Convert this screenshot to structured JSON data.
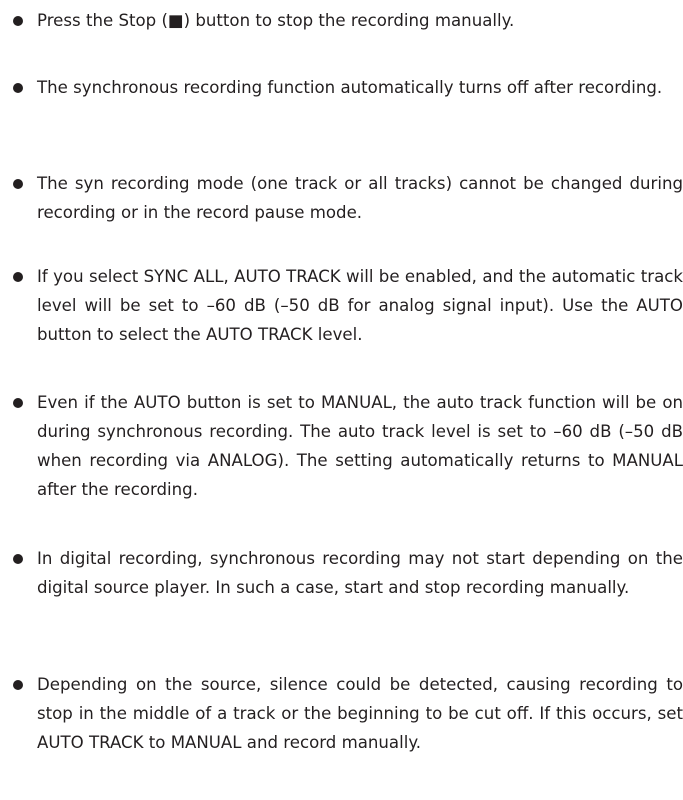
{
  "notes": [
    {
      "text": "Press the Stop (■) button to stop the recording manually."
    },
    {
      "text": "The synchronous recording function automatically turns off after recording."
    },
    {
      "text": "The syn recording mode (one track or all tracks) cannot be changed during recording or in the record pause mode."
    },
    {
      "text": "If you select SYNC ALL, AUTO TRACK will be enabled, and the automatic track level will be set to –60 dB (–50 dB for analog signal input). Use the AUTO button to select the AUTO TRACK level."
    },
    {
      "text": "Even if the AUTO button is set to MANUAL, the auto track function will be on during synchronous recording. The auto track level is set to –60 dB (–50 dB when recording via ANALOG). The setting automatically returns to MANUAL after the recording."
    },
    {
      "text": "In digital recording, synchronous recording may not start depending on the digital source player. In such a case, start and stop recording manually."
    },
    {
      "text": "Depending on the source, silence could be detected, causing recording to stop in the middle of a track or the beginning to be cut off. If this occurs, set AUTO TRACK to MANUAL and record manually."
    }
  ]
}
